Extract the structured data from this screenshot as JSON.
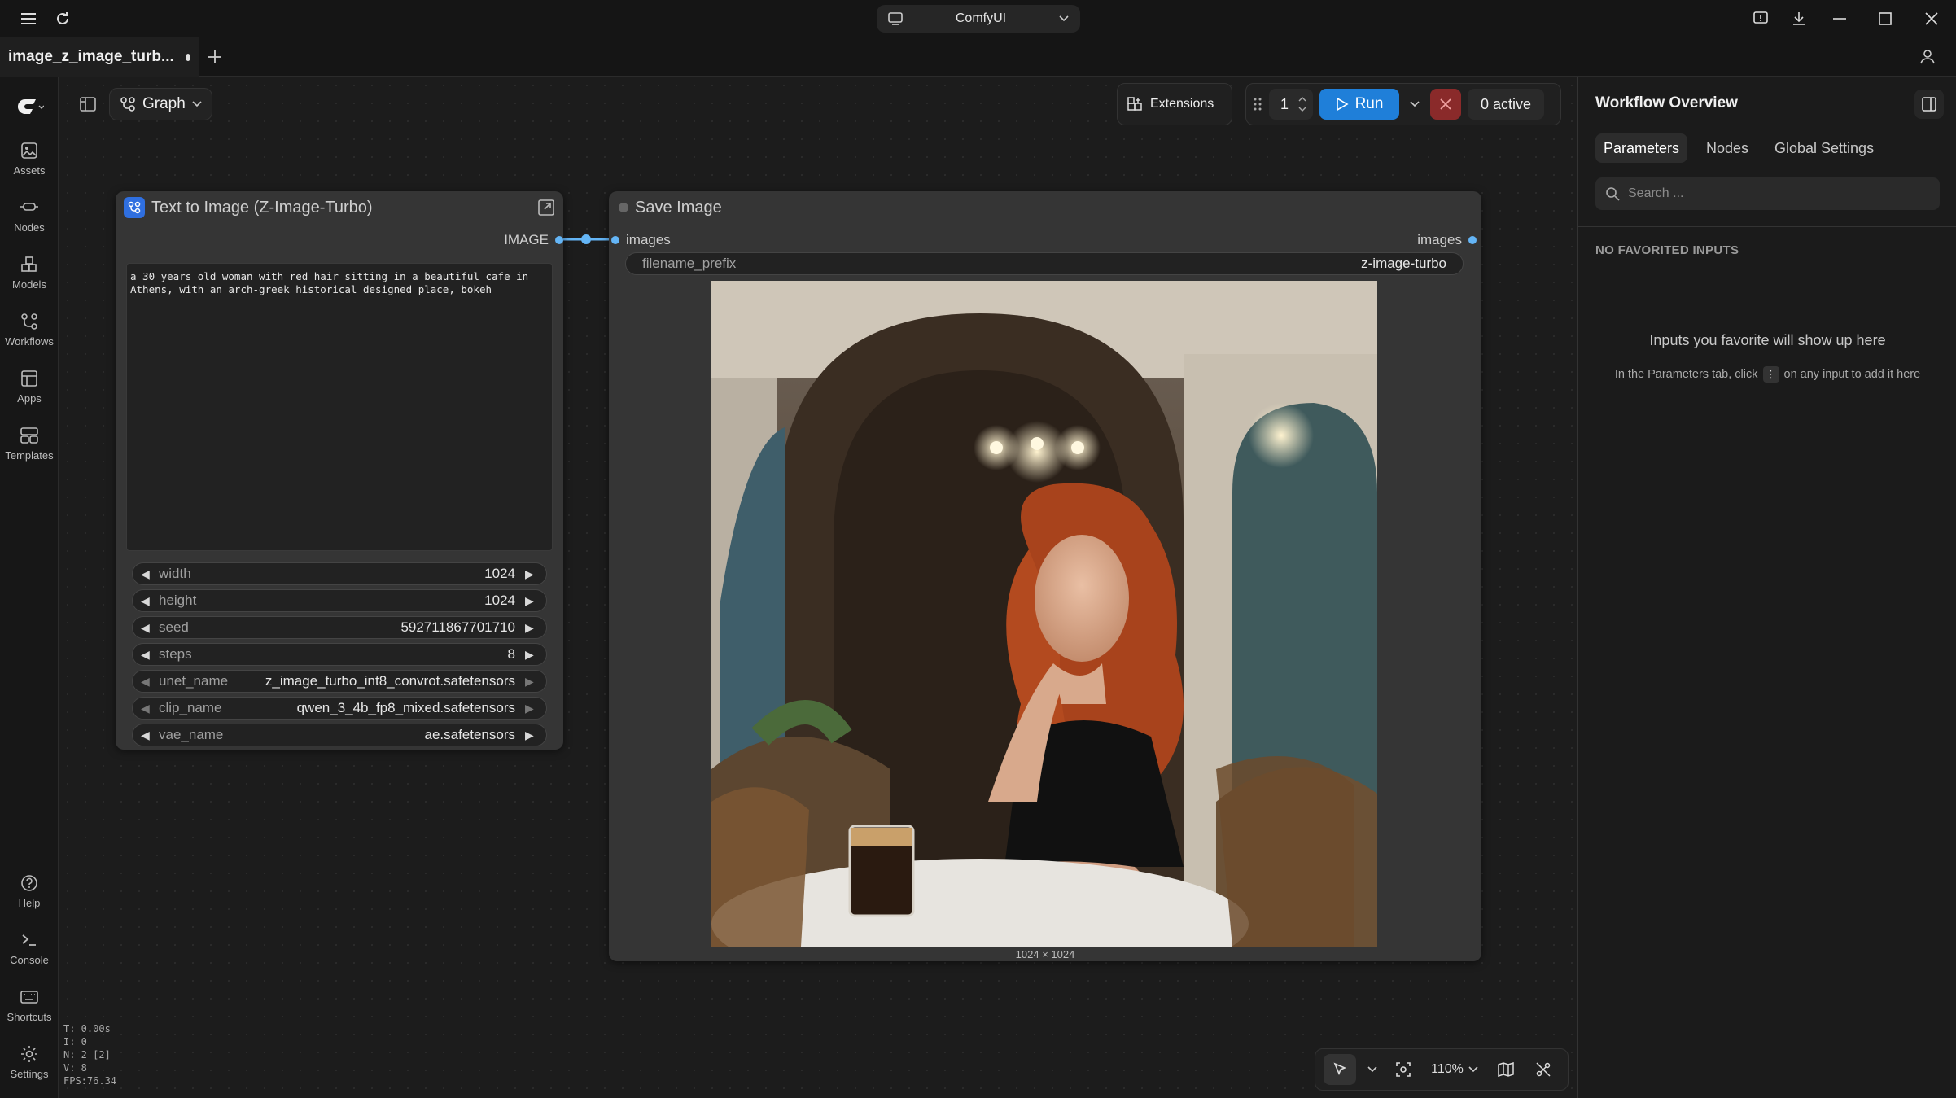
{
  "app": {
    "name": "ComfyUI"
  },
  "tab": {
    "title": "image_z_image_turb..."
  },
  "sidebar": {
    "items": [
      {
        "label": "Assets",
        "icon": "image-icon"
      },
      {
        "label": "Nodes",
        "icon": "nodes-icon"
      },
      {
        "label": "Models",
        "icon": "cubes-icon"
      },
      {
        "label": "Workflows",
        "icon": "workflow-icon"
      },
      {
        "label": "Apps",
        "icon": "apps-icon"
      },
      {
        "label": "Templates",
        "icon": "templates-icon"
      },
      {
        "label": "Help",
        "icon": "help-icon"
      },
      {
        "label": "Console",
        "icon": "terminal-icon"
      },
      {
        "label": "Shortcuts",
        "icon": "keyboard-icon"
      },
      {
        "label": "Settings",
        "icon": "gear-icon"
      }
    ]
  },
  "toolbar": {
    "graph_label": "Graph",
    "extensions_label": "Extensions",
    "queue_count": "1",
    "run_label": "Run",
    "active_label": "0 active"
  },
  "node_t2i": {
    "title": "Text to Image (Z-Image-Turbo)",
    "output_label": "IMAGE",
    "prompt": "a 30 years old woman with red hair sitting in a beautiful cafe in Athens, with an arch-greek historical designed place, bokeh",
    "widgets": [
      {
        "name": "width",
        "value": "1024"
      },
      {
        "name": "height",
        "value": "1024"
      },
      {
        "name": "seed",
        "value": "592711867701710"
      },
      {
        "name": "steps",
        "value": "8"
      },
      {
        "name": "unet_name",
        "value": "z_image_turbo_int8_convrot.safetensors"
      },
      {
        "name": "clip_name",
        "value": "qwen_3_4b_fp8_mixed.safetensors"
      },
      {
        "name": "vae_name",
        "value": "ae.safetensors"
      }
    ]
  },
  "node_save": {
    "title": "Save Image",
    "input_label": "images",
    "output_label": "images",
    "filename_prefix_label": "filename_prefix",
    "filename_prefix_value": "z-image-turbo",
    "image_dims": "1024 × 1024"
  },
  "right_panel": {
    "title": "Workflow Overview",
    "tabs": [
      "Parameters",
      "Nodes",
      "Global Settings"
    ],
    "active_tab": "Parameters",
    "search_placeholder": "Search ...",
    "no_favorites": "NO FAVORITED INPUTS",
    "hint": "Inputs you favorite will show up here",
    "sub_hint_before": "In the Parameters tab, click",
    "sub_hint_kbd": "⋮",
    "sub_hint_after": "on any input to add it here"
  },
  "stats": {
    "t": "T: 0.00s",
    "i": "I: 0",
    "n": "N: 2 [2]",
    "v": "V: 8",
    "fps": "FPS:76.34"
  },
  "canvas_controls": {
    "zoom": "110%"
  },
  "colors": {
    "accent": "#1f7fd9",
    "link": "#64b5f6",
    "danger": "#8a2a2a"
  }
}
